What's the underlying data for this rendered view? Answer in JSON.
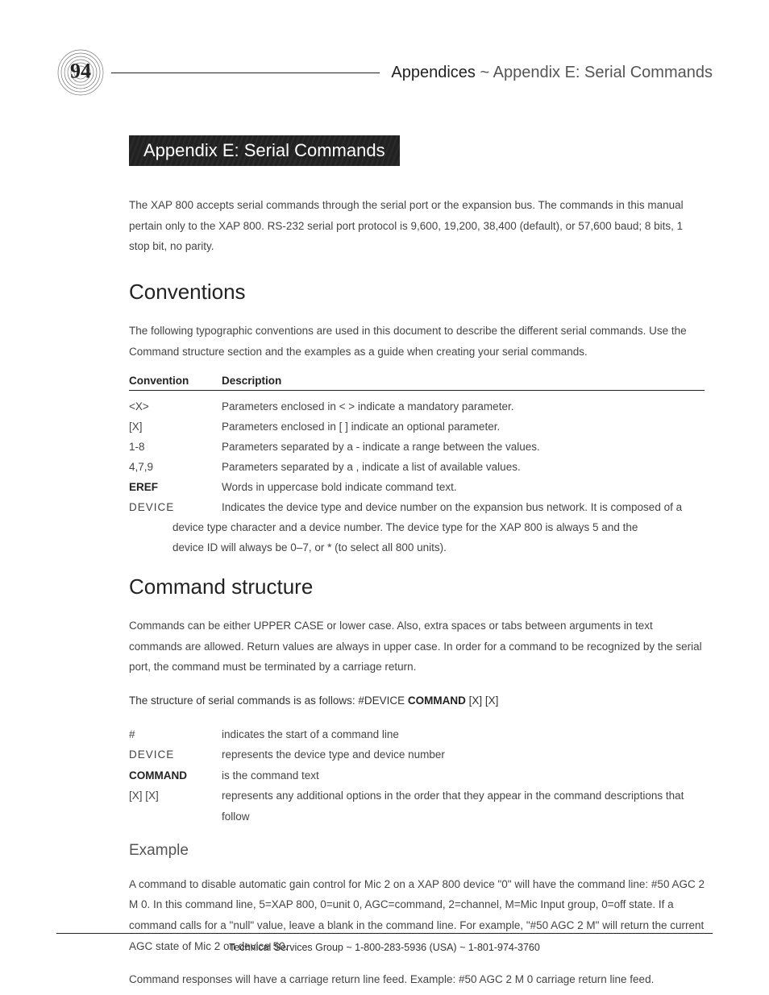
{
  "header": {
    "page_number": "94",
    "section": "Appendices",
    "separator": " ~ ",
    "subsection": "Appendix E: Serial Commands"
  },
  "banner": "Appendix E: Serial Commands",
  "intro": "The XAP 800 accepts serial commands through the serial port or the expansion bus. The commands in this manual pertain only to the XAP 800. RS-232 serial port protocol is 9,600, 19,200, 38,400 (default), or 57,600 baud; 8 bits, 1 stop bit, no parity.",
  "conventions": {
    "heading": "Conventions",
    "intro": "The following typographic conventions are used in this document to describe the different serial commands. Use the Command structure section and the examples as a guide when creating your serial commands.",
    "head_col1": "Convention",
    "head_col2": "Description",
    "rows": [
      {
        "c": "<X>",
        "d": "Parameters enclosed in < > indicate a mandatory parameter."
      },
      {
        "c": "[X]",
        "d": "Parameters enclosed in [ ] indicate an optional parameter."
      },
      {
        "c": "1-8",
        "d": "Parameters separated by a - indicate a range between the values."
      },
      {
        "c": "4,7,9",
        "d": "Parameters separated by a , indicate a list of available values."
      },
      {
        "c": "EREF",
        "d": "Words in uppercase bold indicate command text.",
        "bold": true
      },
      {
        "c": "DEVICE",
        "d": "Indicates the device type and device number on the expansion bus network. It is composed of a",
        "caps": true
      }
    ],
    "cont1": "device type character and a device number. The device type for the XAP 800 is always 5 and the",
    "cont2": "device ID will always be 0–7, or * (to select all 800 units)."
  },
  "command_structure": {
    "heading": "Command structure",
    "intro": "Commands can be either UPPER CASE or lower case. Also, extra spaces or tabs between arguments in text commands are allowed. Return values are always in upper case. In order for a command to be recognized by the serial port, the command must be terminated by a carriage return.",
    "struct_prefix": "The structure of serial commands is as follows:  #DEVICE ",
    "struct_cmd": "COMMAND",
    "struct_suffix": " [X] [X]",
    "rows": [
      {
        "c": "#",
        "d": "indicates the start of a command line"
      },
      {
        "c": "DEVICE",
        "d": "represents the device type and device number",
        "caps": true
      },
      {
        "c": "COMMAND",
        "d": "is the command text",
        "bold": true
      },
      {
        "c": "[X] [X]",
        "d": "represents any additional options in the order that they appear in the command descriptions that follow"
      }
    ]
  },
  "example": {
    "heading": "Example",
    "p1": "A command to disable automatic gain control for Mic 2 on a XAP 800 device \"0\" will have the command line: #50 AGC 2 M 0. In this command line, 5=XAP 800, 0=unit 0, AGC=command, 2=channel, M=Mic Input group, 0=off state. If a command calls for a \"null\" value, leave a blank in the command line. For example, \"#50 AGC 2 M\" will return the current AGC state of Mic 2 on device 50.",
    "p2": "Command responses will have a carriage return line feed. Example: #50 AGC 2 M 0 carriage return line feed."
  },
  "footer": {
    "label": "Technical Services Group",
    "sep": " ~ ",
    "phone1": "1-800-283-5936 (USA)",
    "phone2": "1-801-974-3760"
  }
}
